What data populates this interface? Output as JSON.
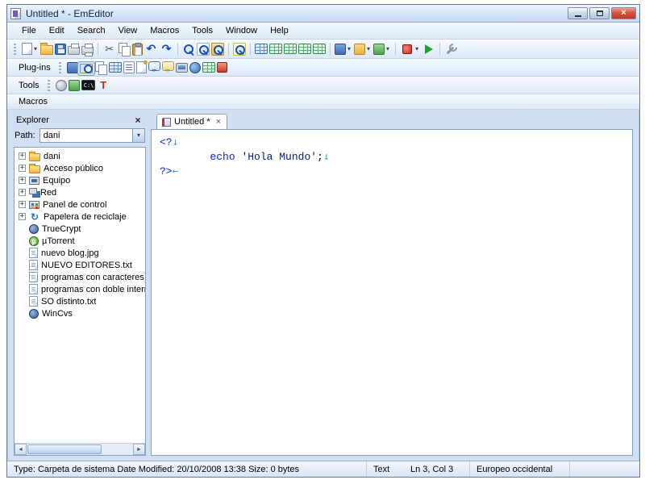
{
  "window": {
    "title": "Untitled * - EmEditor"
  },
  "colors": {
    "close_button": "#c23a28",
    "toolbar_bg": "#dbe8f7",
    "content_bg": "#d0dff2",
    "php_tag": "#0026ff",
    "eol_mark": "#2ea8c8"
  },
  "icons": {
    "dropdown_arrow": "▾",
    "close": "×",
    "plus": "+",
    "scroll_left": "◄",
    "scroll_right": "►"
  },
  "menu": {
    "items": [
      "File",
      "Edit",
      "Search",
      "View",
      "Macros",
      "Tools",
      "Window",
      "Help"
    ]
  },
  "toolbars": {
    "plugins_label": "Plug-ins",
    "tools_label": "Tools",
    "macros_label": "Macros"
  },
  "toolbar_main": [
    {
      "name": "new-document-icon",
      "style": "page",
      "dropdown": true
    },
    {
      "name": "open-icon",
      "style": "folder"
    },
    {
      "name": "save-icon",
      "style": "floppy"
    },
    {
      "name": "print-icon",
      "style": "printer"
    },
    {
      "name": "print-preview-icon",
      "style": "printer2"
    },
    {
      "sep": true
    },
    {
      "name": "cut-icon",
      "style": "cut",
      "glyph": "✂"
    },
    {
      "name": "copy-icon",
      "style": "copy"
    },
    {
      "name": "paste-icon",
      "style": "paste"
    },
    {
      "name": "undo-icon",
      "style": "undo",
      "glyph": "↶"
    },
    {
      "name": "redo-icon",
      "style": "redo",
      "glyph": "↷"
    },
    {
      "sep": true
    },
    {
      "name": "find-icon",
      "style": "mag"
    },
    {
      "name": "replace-icon",
      "style": "magdoc"
    },
    {
      "name": "find-in-files-icon",
      "style": "magfolder"
    },
    {
      "sep": true
    },
    {
      "name": "zoom-icon",
      "style": "magplus"
    },
    {
      "sep": true
    },
    {
      "name": "editor-view-icon",
      "style": "tableblue"
    },
    {
      "name": "wrap-by-characters-icon",
      "style": "table"
    },
    {
      "name": "wrap-by-window-icon",
      "style": "table"
    },
    {
      "name": "wrap-by-page-icon",
      "style": "table"
    },
    {
      "name": "no-wrap-icon",
      "style": "table"
    },
    {
      "sep": true
    },
    {
      "name": "font-icon",
      "style": "blue",
      "dropdown": true
    },
    {
      "name": "configuration-icon",
      "style": "config",
      "dropdown": true
    },
    {
      "name": "encoding-icon",
      "style": "green",
      "dropdown": true
    },
    {
      "sep": true
    },
    {
      "name": "record-macro-icon",
      "style": "record",
      "dropdown": true
    },
    {
      "name": "run-macro-icon",
      "style": "play"
    },
    {
      "sep": true
    },
    {
      "name": "customize-icon",
      "style": "wrench"
    }
  ],
  "toolbar_plugins": [
    {
      "name": "findbar-plugin-icon",
      "style": "blue"
    },
    {
      "name": "explorer-plugin-icon",
      "style": "folderMag",
      "pressed": true
    },
    {
      "name": "open-documents-plugin-icon",
      "style": "copy"
    },
    {
      "name": "html-bar-plugin-icon",
      "style": "tableblue"
    },
    {
      "name": "outline-plugin-icon",
      "style": "list"
    },
    {
      "name": "projects-plugin-icon",
      "style": "page2"
    },
    {
      "name": "snippets-plugin-icon",
      "style": "chat"
    },
    {
      "name": "tooltip-plugin-icon",
      "style": "chat2"
    },
    {
      "name": "word-count-plugin-icon",
      "style": "monitor"
    },
    {
      "name": "web-preview-plugin-icon",
      "style": "globe"
    },
    {
      "name": "word-complete-plugin-icon",
      "style": "tablegreen"
    },
    {
      "name": "transliterate-plugin-icon",
      "style": "redsq"
    }
  ],
  "toolbar_tools": [
    {
      "name": "external-tool-1-icon",
      "style": "gear"
    },
    {
      "name": "external-tool-2-icon",
      "style": "green2"
    },
    {
      "name": "command-prompt-icon",
      "style": "console",
      "glyph": "C:\\"
    },
    {
      "name": "external-tool-truecrypt-icon",
      "style": "redT",
      "glyph": "T"
    }
  ],
  "explorer": {
    "title": "Explorer",
    "path_label": "Path:",
    "path_value": "dani",
    "items": [
      {
        "label": "dani",
        "icon": "folder",
        "expand": true
      },
      {
        "label": "Acceso público",
        "icon": "folder",
        "expand": true
      },
      {
        "label": "Equipo",
        "icon": "computer",
        "expand": true
      },
      {
        "label": "Red",
        "icon": "network",
        "expand": true
      },
      {
        "label": "Panel de control",
        "icon": "control",
        "expand": true
      },
      {
        "label": "Papelera de reciclaje",
        "icon": "recycle",
        "g": "↻",
        "expand": true
      },
      {
        "label": "TrueCrypt",
        "icon": "appblue",
        "expand": false
      },
      {
        "label": "µTorrent",
        "icon": "utorrent",
        "g": "µ",
        "expand": false
      },
      {
        "label": "nuevo blog.jpg",
        "icon": "file",
        "expand": false
      },
      {
        "label": "NUEVO EDITORES.txt",
        "icon": "file",
        "expand": false
      },
      {
        "label": "programas con caracteres ra",
        "icon": "file",
        "expand": false
      },
      {
        "label": "programas con doble interro",
        "icon": "file",
        "expand": false
      },
      {
        "label": "SO distinto.txt",
        "icon": "file",
        "expand": false
      },
      {
        "label": "WinCvs",
        "icon": "appblue",
        "expand": false
      }
    ]
  },
  "editor": {
    "tab_label": "Untitled *",
    "lines": [
      {
        "segments": [
          {
            "t": "<?",
            "c": "tag"
          }
        ],
        "eol": "↓"
      },
      {
        "segments": [
          {
            "t": "        ",
            "c": "plain"
          },
          {
            "t": "echo",
            "c": "keyword"
          },
          {
            "t": " ",
            "c": "plain"
          },
          {
            "t": "'Hola Mundo'",
            "c": "string"
          },
          {
            "t": ";",
            "c": "plain"
          }
        ],
        "eol": "↓"
      },
      {
        "segments": [
          {
            "t": "?>",
            "c": "tag"
          }
        ],
        "eol": "←"
      }
    ]
  },
  "status_bar": {
    "file_info": "Type: Carpeta de sistema Date Modified: 20/10/2008 13:38 Size: 0 bytes",
    "mode": "Text",
    "position": "Ln 3, Col 3",
    "encoding": "Europeo occidental"
  }
}
